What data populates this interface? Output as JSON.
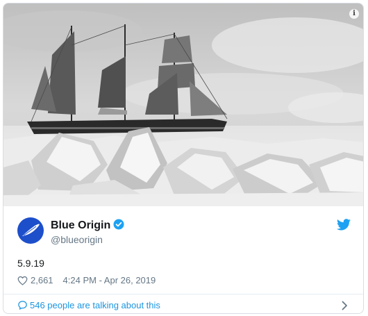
{
  "tweet": {
    "display_name": "Blue Origin",
    "handle": "@blueorigin",
    "text": "5.9.19",
    "like_count": "2,661",
    "timestamp": "4:24 PM - Apr 26, 2019",
    "talking_text": "546 people are talking about this",
    "info_glyph": "i"
  },
  "icons": {
    "info": "info-icon",
    "verified": "verified-badge-icon",
    "twitter": "twitter-bird-icon",
    "like": "heart-icon",
    "reply": "speech-bubble-icon",
    "chevron": "chevron-right-icon"
  },
  "colors": {
    "brand_blue": "#1da1f2",
    "link_blue": "#1b95e0",
    "avatar_blue": "#1d4fcb",
    "text_dark": "#14171a",
    "text_gray": "#657786"
  }
}
